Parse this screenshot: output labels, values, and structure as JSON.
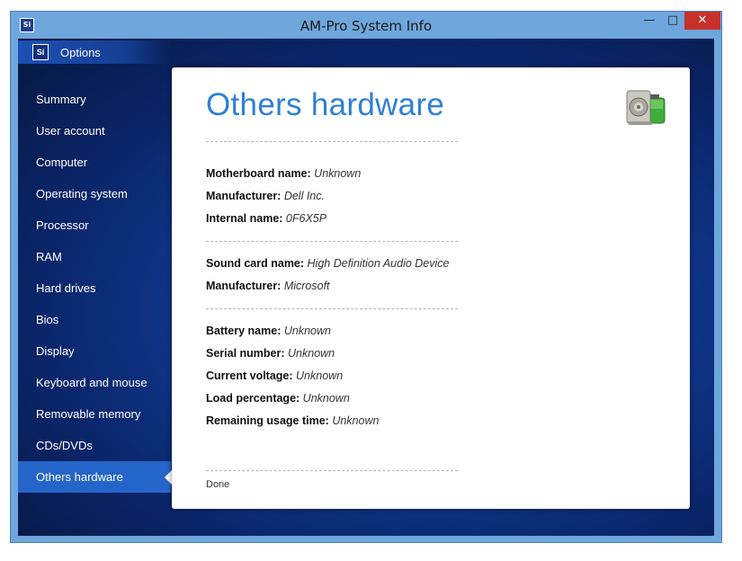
{
  "window": {
    "title": "AM-Pro System Info",
    "icon_text": "Si"
  },
  "header": {
    "logo_text": "Si",
    "options_label": "Options"
  },
  "sidebar": {
    "items": [
      {
        "label": "Summary"
      },
      {
        "label": "User account"
      },
      {
        "label": "Computer"
      },
      {
        "label": "Operating system"
      },
      {
        "label": "Processor"
      },
      {
        "label": "RAM"
      },
      {
        "label": "Hard drives"
      },
      {
        "label": "Bios"
      },
      {
        "label": "Display"
      },
      {
        "label": "Keyboard and mouse"
      },
      {
        "label": "Removable memory"
      },
      {
        "label": "CDs/DVDs"
      },
      {
        "label": "Others hardware"
      }
    ],
    "active_index": 12
  },
  "main": {
    "title": "Others hardware",
    "motherboard": {
      "name_label": "Motherboard name:",
      "name_value": "Unknown",
      "manufacturer_label": "Manufacturer:",
      "manufacturer_value": "Dell Inc.",
      "internal_label": "Internal name:",
      "internal_value": "0F6X5P"
    },
    "sound": {
      "name_label": "Sound card name:",
      "name_value": "High Definition Audio Device",
      "manufacturer_label": "Manufacturer:",
      "manufacturer_value": "Microsoft"
    },
    "battery": {
      "name_label": "Battery name:",
      "name_value": "Unknown",
      "serial_label": "Serial number:",
      "serial_value": "Unknown",
      "voltage_label": "Current voltage:",
      "voltage_value": "Unknown",
      "load_label": "Load percentage:",
      "load_value": "Unknown",
      "remaining_label": "Remaining usage time:",
      "remaining_value": "Unknown"
    },
    "status": "Done"
  },
  "icons": {
    "hardware": "speaker-battery-icon",
    "minimize": "minimize-icon",
    "maximize": "maximize-icon",
    "close": "close-icon"
  },
  "colors": {
    "accent": "#2f7fd6",
    "active_nav": "#2565c9",
    "close_button": "#c7312b"
  }
}
